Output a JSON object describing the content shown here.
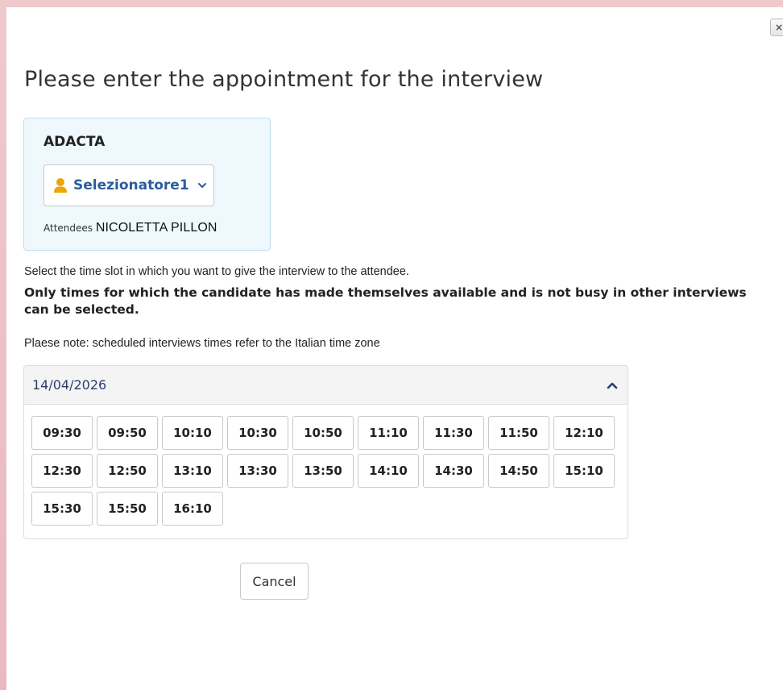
{
  "dialog": {
    "close_label": "×",
    "title": "Please enter the appointment for the interview"
  },
  "company": {
    "name": "ADACTA",
    "recruiter": "Selezionatore1",
    "attendees_label": "Attendees",
    "attendee_name": "NICOLETTA PILLON"
  },
  "instructions": {
    "select_text": "Select the time slot in which you want to give the interview to the attendee.",
    "availability_note": "Only times for which the candidate has made themselves available and is not busy in other interviews can be selected.",
    "timezone_note": "Plaese note: scheduled interviews times refer to the Italian time zone"
  },
  "schedule": {
    "date": "14/04/2026",
    "slots": [
      "09:30",
      "09:50",
      "10:10",
      "10:30",
      "10:50",
      "11:10",
      "11:30",
      "11:50",
      "12:10",
      "12:30",
      "12:50",
      "13:10",
      "13:30",
      "13:50",
      "14:10",
      "14:30",
      "14:50",
      "15:10",
      "15:30",
      "15:50",
      "16:10"
    ]
  },
  "actions": {
    "cancel_label": "Cancel"
  },
  "colors": {
    "accent": "#2a5d9e",
    "user_icon": "#f0a500",
    "box_background": "#eef8fd"
  },
  "icons": {
    "close": "close-icon",
    "recruiter": "user-icon",
    "dropdown": "chevron-down-icon",
    "collapse": "chevron-up-icon"
  }
}
